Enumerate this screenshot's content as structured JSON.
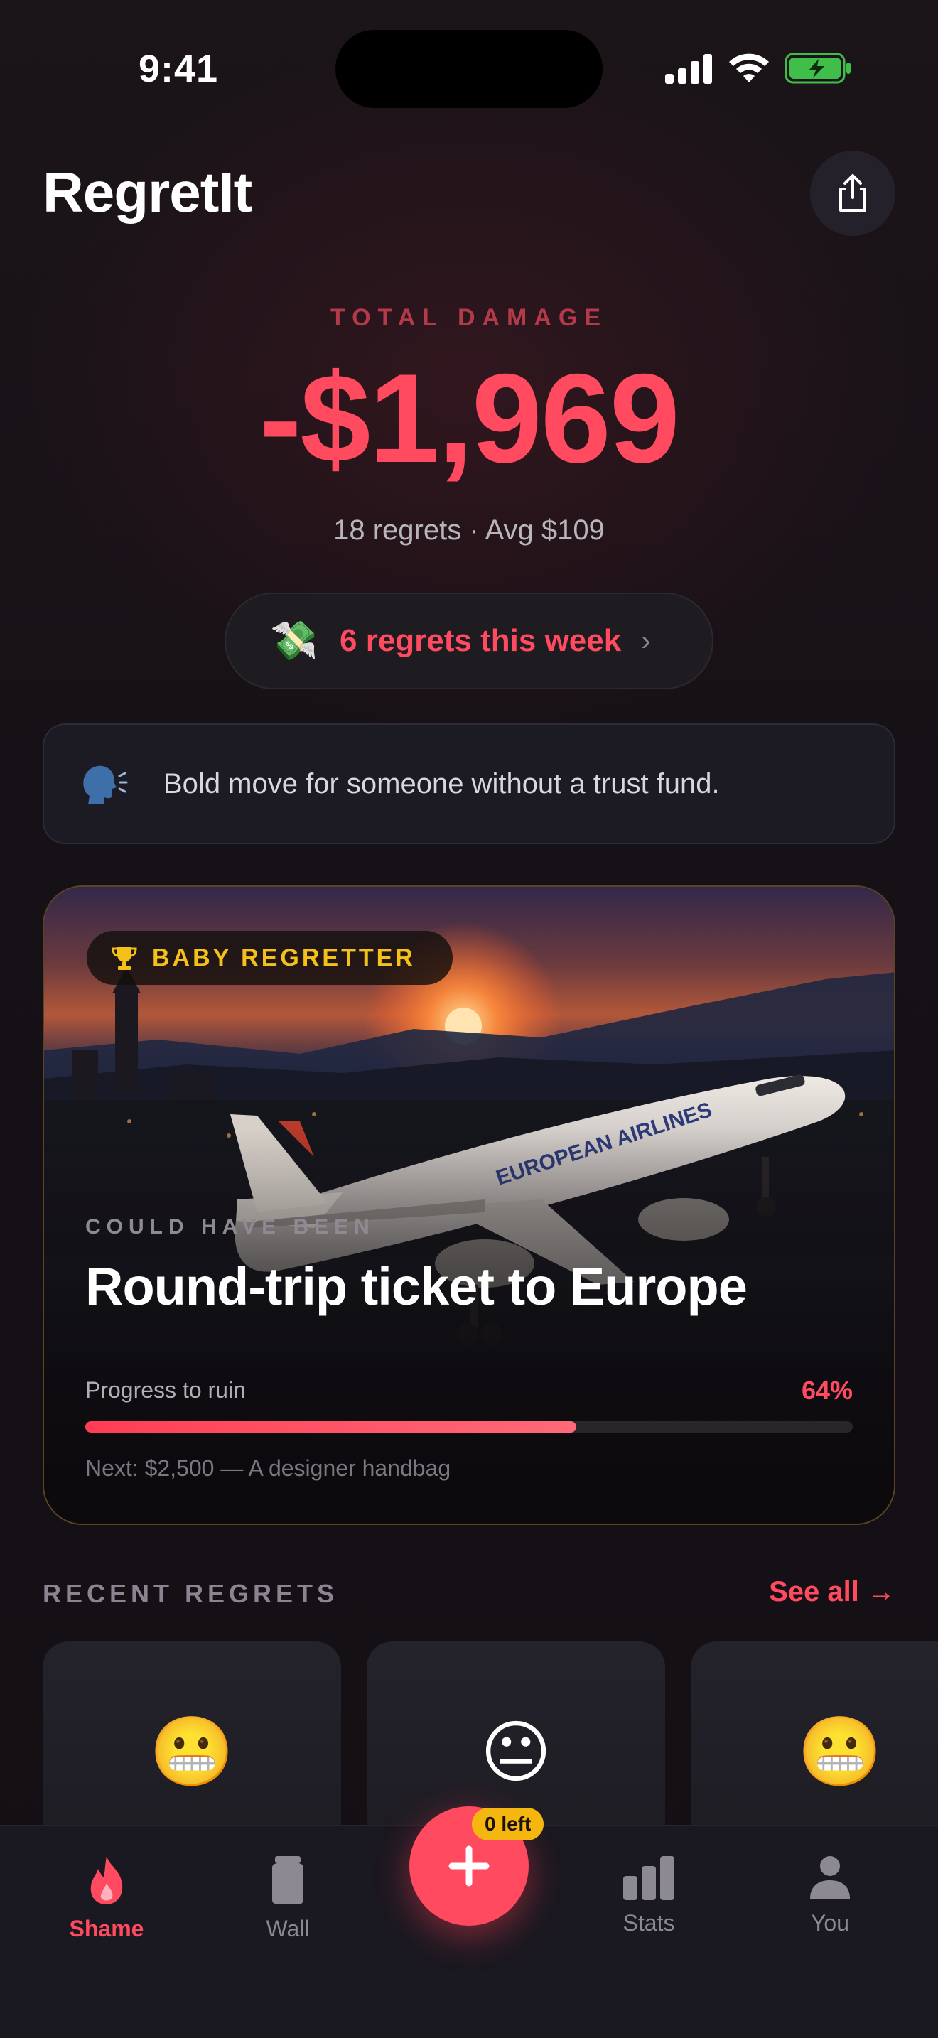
{
  "status_bar": {
    "time": "9:41"
  },
  "header": {
    "app_title": "RegretIt",
    "share_icon": "share-icon"
  },
  "total": {
    "label": "TOTAL DAMAGE",
    "amount": "-$1,969",
    "summary": "18 regrets · Avg $109"
  },
  "week_pill": {
    "emoji": "💸",
    "text": "6 regrets this week",
    "chevron": "›"
  },
  "roast": {
    "icon": "speaking-head-icon",
    "text": "Bold move for someone without a trust fund."
  },
  "milestone": {
    "badge": "BABY REGRETTER",
    "eyebrow": "COULD HAVE BEEN",
    "title": "Round-trip ticket to Europe",
    "progress_label": "Progress to ruin",
    "progress_percent_text": "64%",
    "progress_value": 0.64,
    "next": "Next: $2,500 — A designer handbag",
    "plane_livery": "EUROPEAN AIRLINES"
  },
  "recent": {
    "title": "RECENT REGRETS",
    "see_all": "See all →",
    "items": [
      {
        "emoji": "😬"
      },
      {
        "emoji": "😐"
      },
      {
        "emoji": "😬"
      }
    ]
  },
  "fab": {
    "badge": "0 left"
  },
  "tabs": [
    {
      "label": "Shame",
      "icon": "flame-icon",
      "active": true
    },
    {
      "label": "Wall",
      "icon": "jar-icon",
      "active": false
    },
    {
      "label": "Stats",
      "icon": "bar-chart-icon",
      "active": false
    },
    {
      "label": "You",
      "icon": "person-icon",
      "active": false
    }
  ],
  "colors": {
    "accent": "#ff4a5f",
    "gold": "#f5c018",
    "background": "#141015"
  }
}
